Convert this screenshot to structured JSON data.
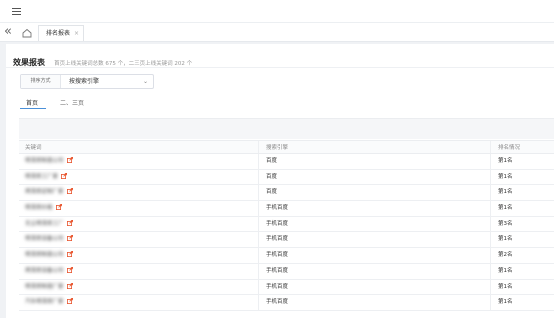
{
  "app": {
    "menu_icon": "menu-icon"
  },
  "tabs": {
    "back_icon": "double-chevron-left-icon",
    "back_glyph": "«",
    "home_icon": "home-icon",
    "active_tab_label": "排名报表",
    "close_glyph": "×"
  },
  "page": {
    "title": "效果报表",
    "subtitle": "首页上线关键词总数 675 个，二三页上线关键词 202 个"
  },
  "filter": {
    "label": "排序方式",
    "value": "按搜索引擎",
    "arrow_glyph": "⌄"
  },
  "subtabs": [
    {
      "label": "首页"
    },
    {
      "label": "二、三页"
    }
  ],
  "table": {
    "headers": [
      "关键词",
      "搜索引擎",
      "排名情况"
    ],
    "rows": [
      {
        "keyword": "喷漆房制造公司",
        "engine": "百度",
        "rank": "第1名"
      },
      {
        "keyword": "喷漆房工厂家",
        "engine": "百度",
        "rank": "第1名"
      },
      {
        "keyword": "烤漆房定制厂家",
        "engine": "百度",
        "rank": "第1名"
      },
      {
        "keyword": "喷漆房价格",
        "engine": "手机百度",
        "rank": "第1名"
      },
      {
        "keyword": "无尘喷漆房工厂",
        "engine": "手机百度",
        "rank": "第3名"
      },
      {
        "keyword": "喷漆房设备公司",
        "engine": "手机百度",
        "rank": "第1名"
      },
      {
        "keyword": "喷漆房制造公司",
        "engine": "手机百度",
        "rank": "第2名"
      },
      {
        "keyword": "烤漆房设备公司",
        "engine": "手机百度",
        "rank": "第1名"
      },
      {
        "keyword": "喷漆房制造厂家",
        "engine": "手机百度",
        "rank": "第1名"
      },
      {
        "keyword": "汽车喷漆房厂家",
        "engine": "手机百度",
        "rank": "第1名"
      }
    ],
    "keyword_icon": "trend-icon",
    "accent_color": "#e8542d"
  },
  "colors": {
    "accent": "#4a90d9",
    "trend_icon": "#e8542d"
  }
}
